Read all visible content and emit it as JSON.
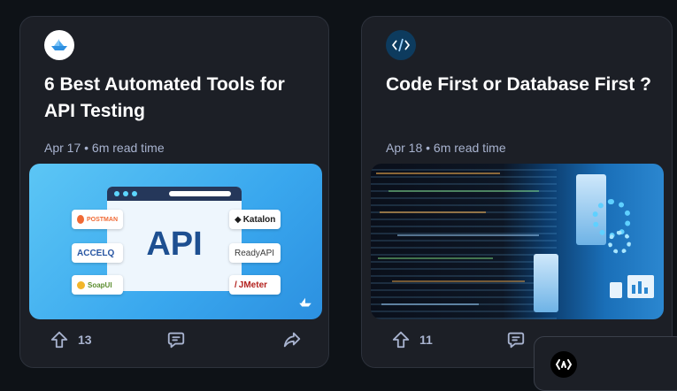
{
  "cards": [
    {
      "title": "6 Best Automated Tools for API Testing",
      "meta": "Apr 17 • 6m read time",
      "upvotes": "13",
      "thumb": {
        "center_text": "API",
        "logos_left": [
          "POSTMAN",
          "ACCELQ",
          "SoapUI"
        ],
        "logos_right": [
          "Katalon",
          "ReadyAPI",
          "JMeter"
        ]
      }
    },
    {
      "title": "Code First or Database First ?",
      "meta": "Apr 18 • 6m read time",
      "upvotes": "11"
    }
  ],
  "colors": {
    "background": "#0e1217",
    "card": "#1c1f26",
    "text_secondary": "#a8b3cf",
    "api_blue": "#1d4f91",
    "accent_blue": "#1ea7fd"
  },
  "icons": {
    "card1_source": "paper-boat-icon",
    "card2_source": "code-pen-icon",
    "upvote": "arrow-up-icon",
    "comment": "comment-icon",
    "share": "share-arrow-icon"
  }
}
